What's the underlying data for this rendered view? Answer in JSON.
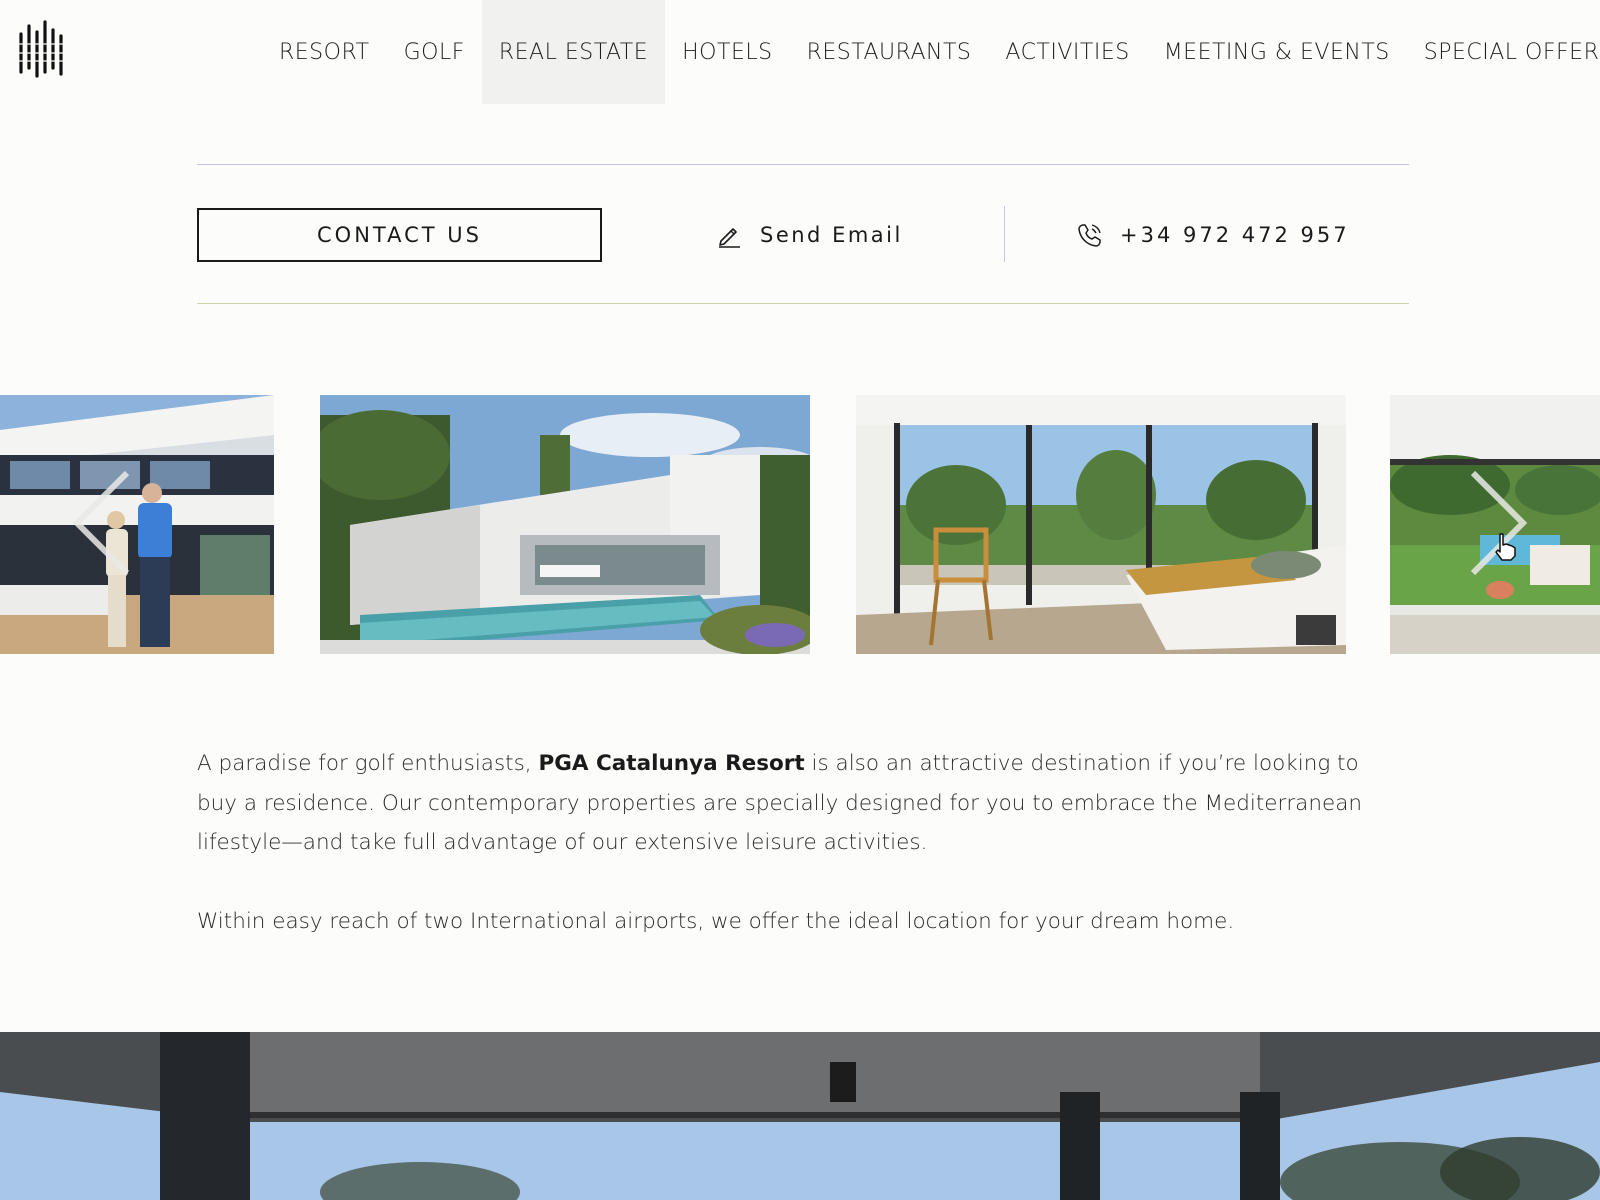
{
  "nav": {
    "items": [
      {
        "label": "RESORT"
      },
      {
        "label": "GOLF"
      },
      {
        "label": "REAL ESTATE",
        "active": true
      },
      {
        "label": "HOTELS"
      },
      {
        "label": "RESTAURANTS"
      },
      {
        "label": "ACTIVITIES"
      },
      {
        "label": "MEETING & EVENTS"
      },
      {
        "label": "SPECIAL OFFERS"
      }
    ]
  },
  "contact": {
    "button_label": "CONTACT US",
    "email_label": "Send Email",
    "phone_label": "+34 972 472 957",
    "email_icon": "pencil-icon",
    "phone_icon": "phone-icon"
  },
  "carousel": {
    "slides": [
      {
        "name": "couple-at-villa"
      },
      {
        "name": "villa-with-pool"
      },
      {
        "name": "bedroom-view"
      },
      {
        "name": "terrace-garden"
      }
    ],
    "prev_icon": "chevron-left-icon",
    "next_icon": "chevron-right-icon"
  },
  "intro": {
    "p1_before": "A paradise for golf enthusiasts, ",
    "p1_brand": "PGA Catalunya Resort",
    "p1_after": " is also an attractive destination if you’re looking to buy a residence. Our contemporary properties are specially designed for you to embrace the Mediterranean lifestyle—and take full advantage of our extensive leisure activities.",
    "p2": "Within easy reach of two International airports, we offer the ideal location for your dream home."
  },
  "colors": {
    "background": "#fcfcfb",
    "active_nav_bg": "#f1f1ef",
    "text": "#1f1f1f",
    "rule_top": "#c3c6e4",
    "rule_bottom": "#cfd6a6"
  }
}
